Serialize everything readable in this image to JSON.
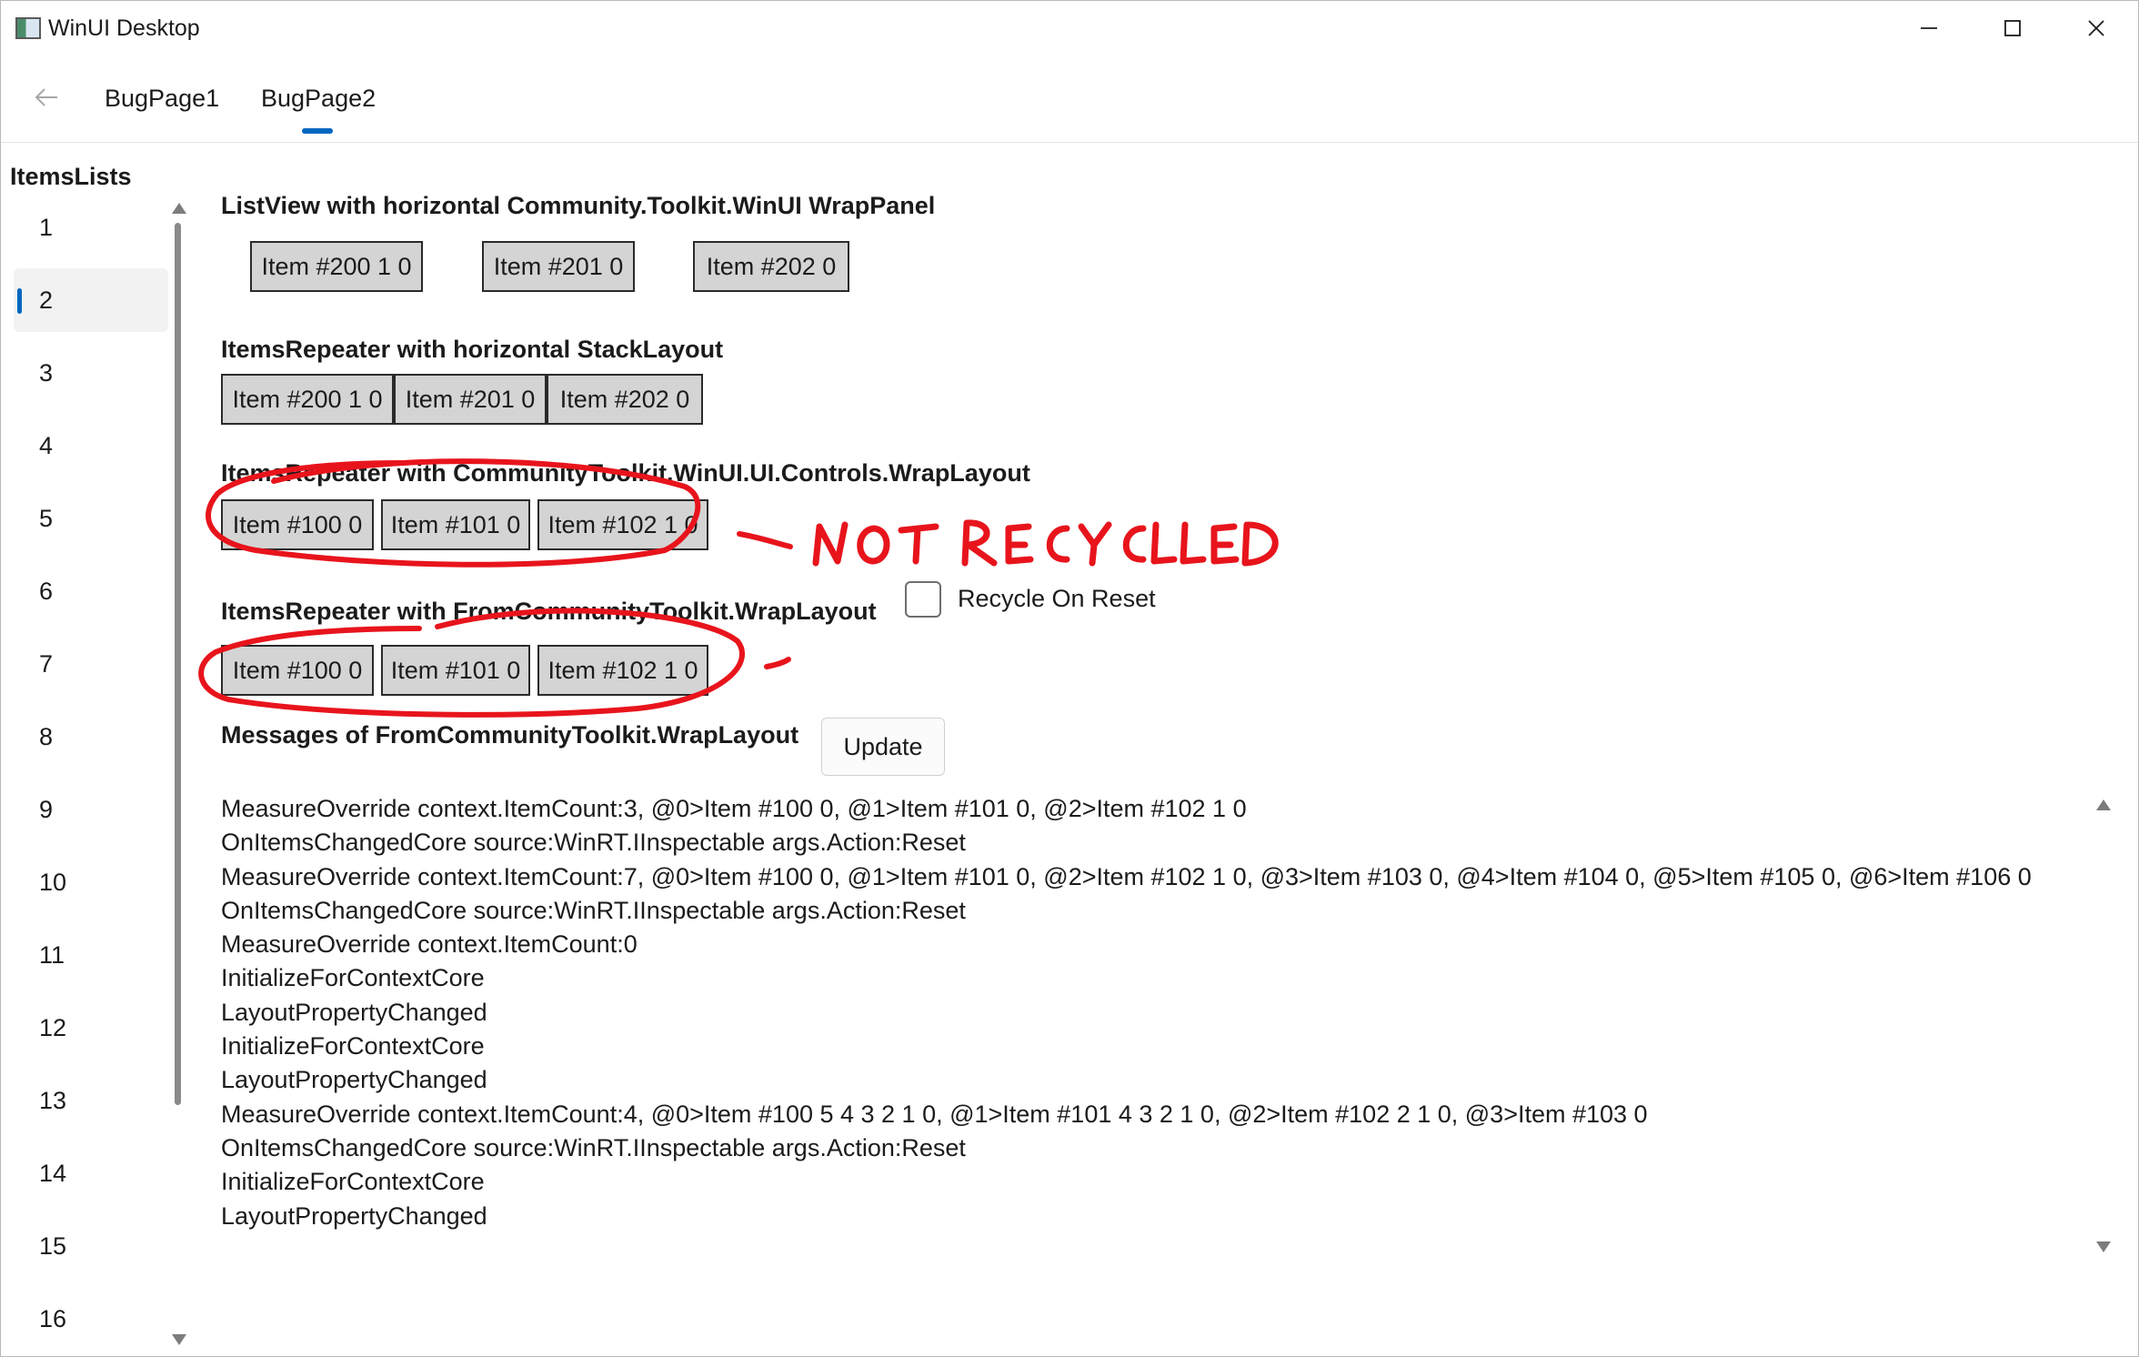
{
  "window": {
    "title": "WinUI Desktop"
  },
  "nav": {
    "tabs": [
      {
        "label": "BugPage1",
        "selected": false
      },
      {
        "label": "BugPage2",
        "selected": true
      }
    ]
  },
  "sidebar": {
    "header": "ItemsLists",
    "items": [
      "1",
      "2",
      "3",
      "4",
      "5",
      "6",
      "7",
      "8",
      "9",
      "10",
      "11",
      "12",
      "13",
      "14",
      "15",
      "16"
    ],
    "selected_index": 1
  },
  "sections": {
    "listview": {
      "title": "ListView with horizontal Community.Toolkit.WinUI WrapPanel",
      "items": [
        "Item #200 1 0",
        "Item #201 0",
        "Item #202 0"
      ]
    },
    "stacklayout": {
      "title": "ItemsRepeater with horizontal StackLayout",
      "items": [
        "Item #200 1 0",
        "Item #201 0",
        "Item #202 0"
      ]
    },
    "wraplayout": {
      "title": "ItemsRepeater with CommunityToolkit.WinUI.UI.Controls.WrapLayout",
      "items": [
        "Item #100 0",
        "Item #101 0",
        "Item #102 1 0"
      ]
    },
    "fromtoolkit": {
      "title": "ItemsRepeater with FromCommunityToolkit.WrapLayout",
      "items": [
        "Item #100 0",
        "Item #101 0",
        "Item #102 1 0"
      ],
      "checkbox_label": "Recycle On Reset",
      "checkbox_checked": false
    },
    "messages": {
      "title": "Messages of FromCommunityToolkit.WrapLayout",
      "update_label": "Update",
      "lines": [
        "MeasureOverride context.ItemCount:3, @0>Item #100 0, @1>Item #101 0, @2>Item #102 1 0",
        "OnItemsChangedCore source:WinRT.IInspectable args.Action:Reset",
        "MeasureOverride context.ItemCount:7, @0>Item #100 0, @1>Item #101 0, @2>Item #102 1 0, @3>Item #103 0, @4>Item #104 0, @5>Item #105 0, @6>Item #106 0",
        "OnItemsChangedCore source:WinRT.IInspectable args.Action:Reset",
        "MeasureOverride context.ItemCount:0",
        "InitializeForContextCore",
        "LayoutPropertyChanged",
        "InitializeForContextCore",
        "LayoutPropertyChanged",
        "MeasureOverride context.ItemCount:4, @0>Item #100 5 4 3 2 1 0, @1>Item #101 4 3 2 1 0, @2>Item #102 2 1 0, @3>Item #103 0",
        "OnItemsChangedCore source:WinRT.IInspectable args.Action:Reset",
        "InitializeForContextCore",
        "LayoutPropertyChanged"
      ]
    }
  },
  "annotation": {
    "handwritten_note": "NOT RECYCLED",
    "ink_color": "#e8141c"
  },
  "colors": {
    "accent": "#0067c0",
    "chip_fill": "#d4d4d4"
  }
}
